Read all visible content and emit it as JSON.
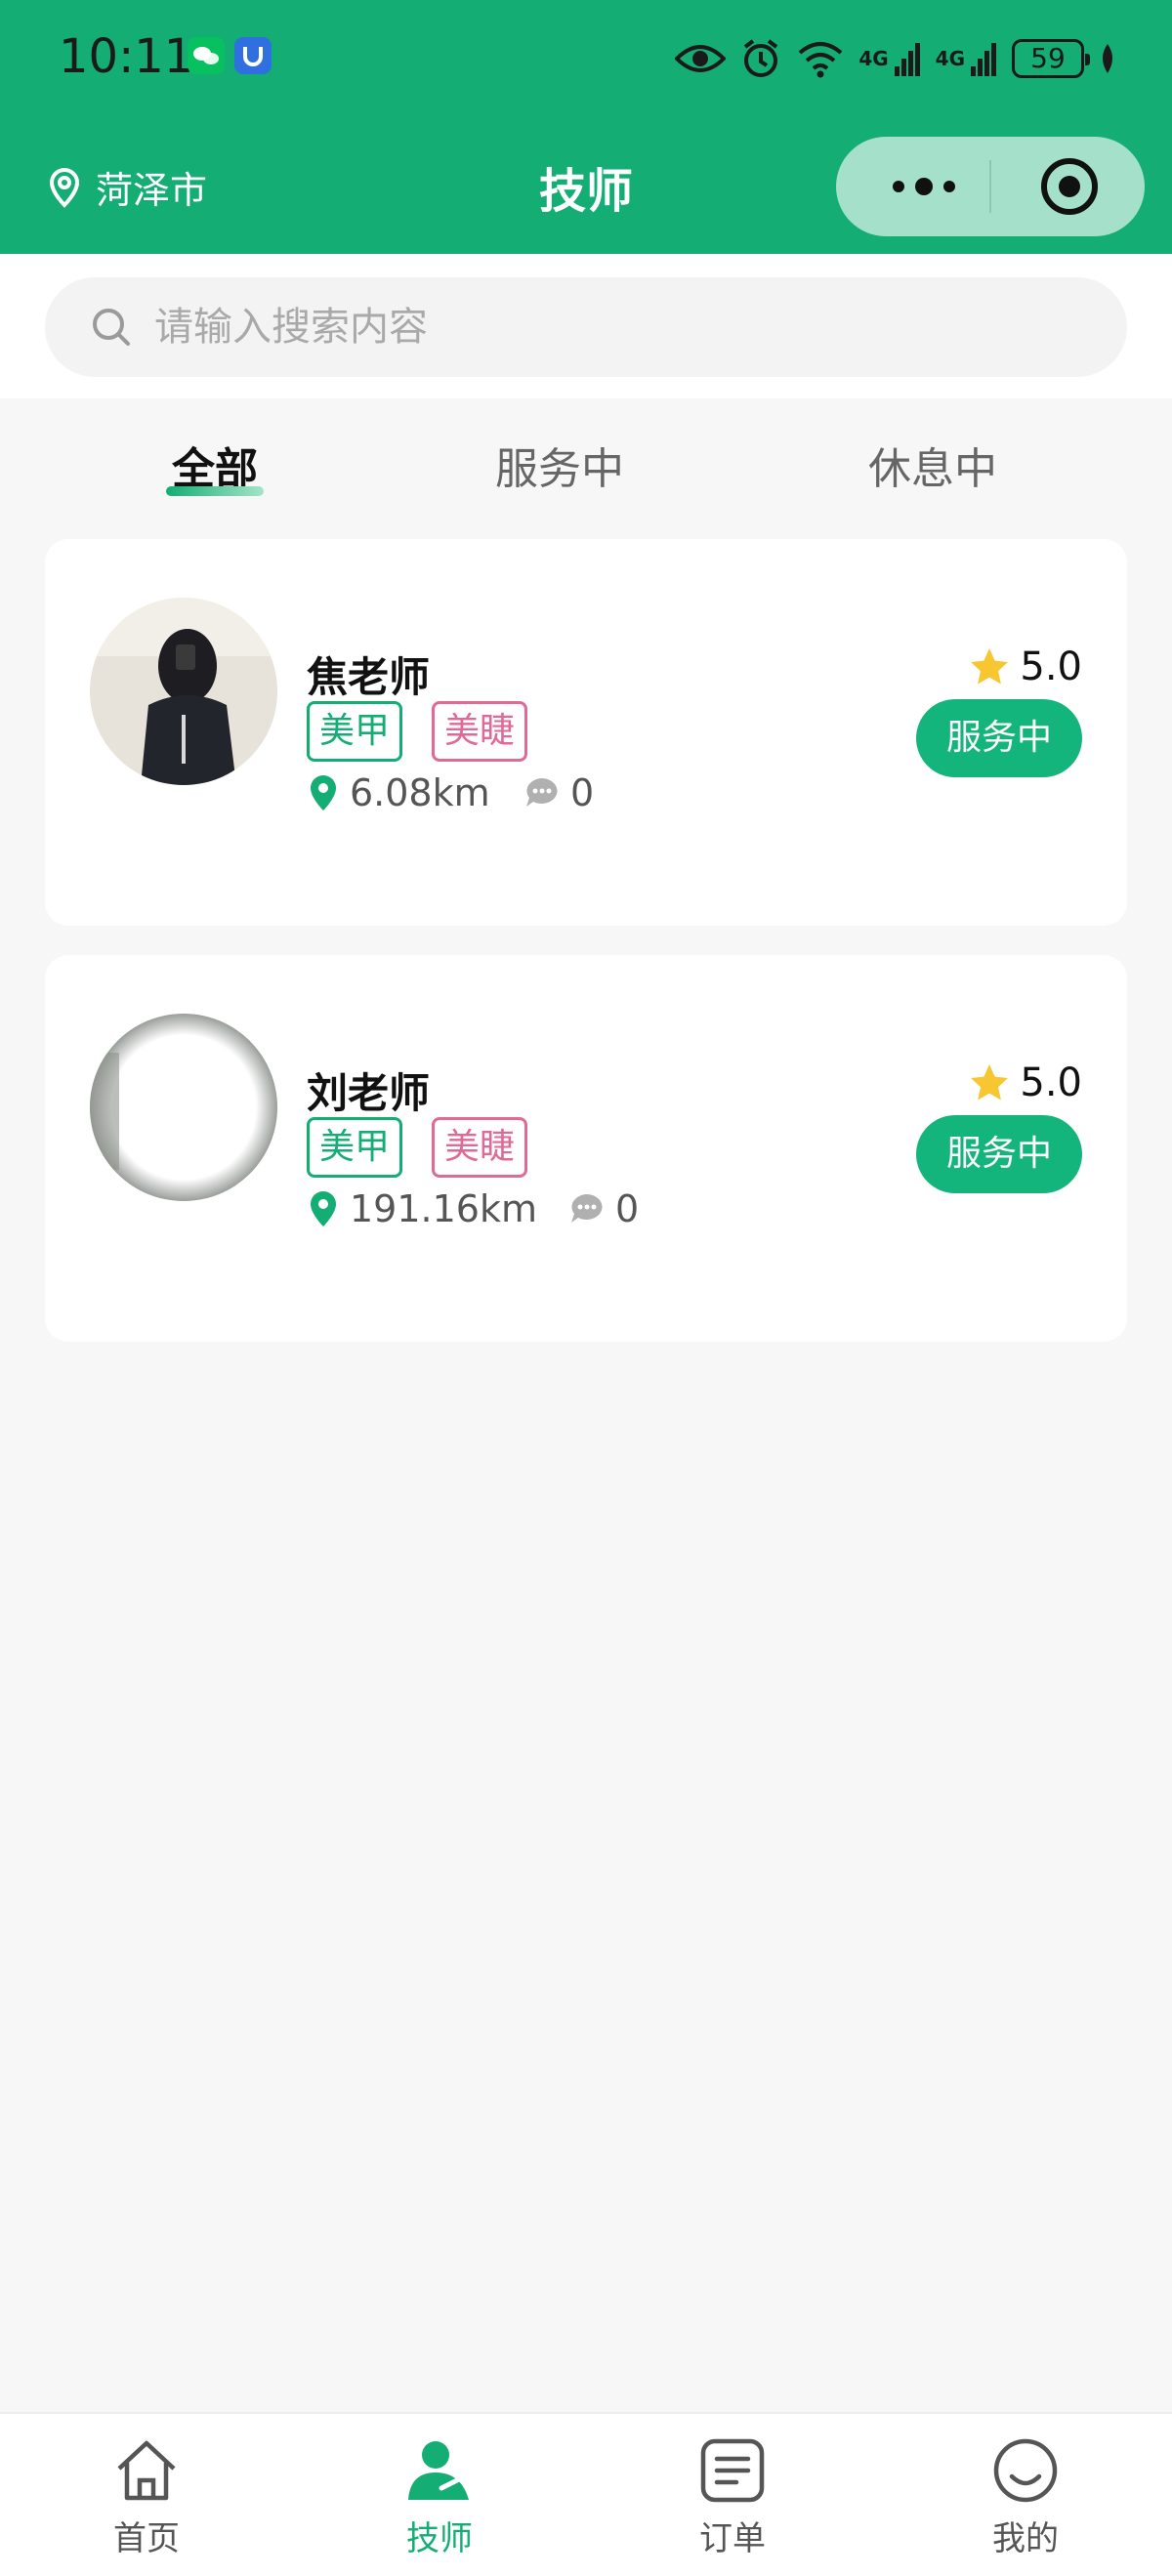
{
  "status_bar": {
    "time": "10:11",
    "network_1": "4G",
    "network_2": "4G",
    "battery": "59"
  },
  "nav": {
    "city": "菏泽市",
    "title": "技师"
  },
  "search": {
    "placeholder": "请输入搜索内容"
  },
  "tabs": [
    {
      "label": "全部",
      "active": true
    },
    {
      "label": "服务中",
      "active": false
    },
    {
      "label": "休息中",
      "active": false
    }
  ],
  "technicians": [
    {
      "name": "焦老师",
      "tags": [
        "美甲",
        "美睫"
      ],
      "distance": "6.08km",
      "comments": "0",
      "rating": "5.0",
      "status": "服务中"
    },
    {
      "name": "刘老师",
      "tags": [
        "美甲",
        "美睫"
      ],
      "distance": "191.16km",
      "comments": "0",
      "rating": "5.0",
      "status": "服务中"
    }
  ],
  "tabbar": [
    {
      "label": "首页",
      "icon": "home-icon",
      "active": false
    },
    {
      "label": "技师",
      "icon": "technician-icon",
      "active": true
    },
    {
      "label": "订单",
      "icon": "order-icon",
      "active": false
    },
    {
      "label": "我的",
      "icon": "profile-icon",
      "active": false
    }
  ],
  "colors": {
    "brand": "#14ad74",
    "tag_pink": "#e06a95",
    "star": "#f7c631"
  }
}
